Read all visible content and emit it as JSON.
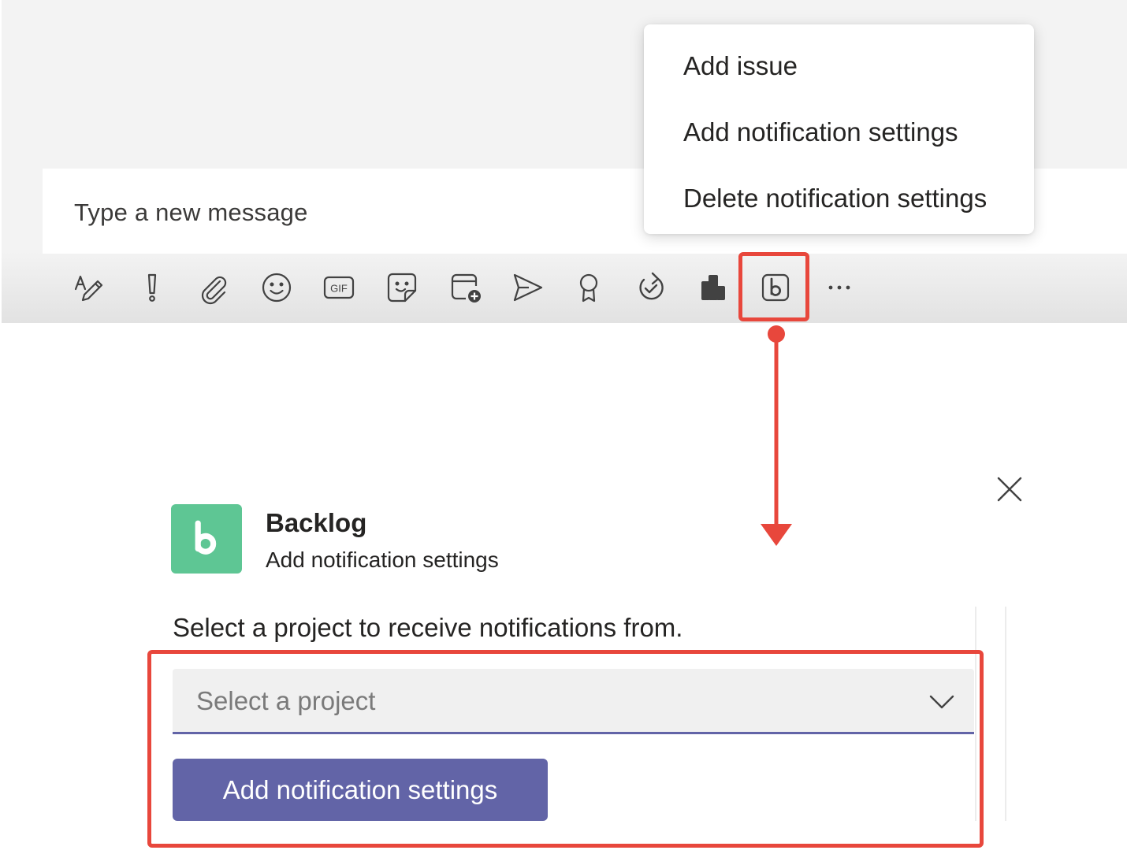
{
  "compose": {
    "placeholder": "Type a new message"
  },
  "toolbar": {
    "icons": [
      "format-icon",
      "important-icon",
      "attach-icon",
      "emoji-icon",
      "gif-icon",
      "sticker-icon",
      "schedule-meeting-icon",
      "send-icon",
      "praise-icon",
      "loop-icon",
      "app-icon",
      "backlog-icon",
      "more-icon"
    ],
    "gif_label": "GIF",
    "more_label": "···"
  },
  "menu": {
    "items": [
      {
        "label": "Add issue"
      },
      {
        "label": "Add notification settings"
      },
      {
        "label": "Delete notification settings"
      }
    ]
  },
  "dialog": {
    "app_name": "Backlog",
    "subtitle": "Add notification settings",
    "prompt": "Select a project to receive notifications from.",
    "select": {
      "placeholder": "Select a project"
    },
    "submit_label": "Add notification settings"
  },
  "colors": {
    "highlight": "#e8473c",
    "primary": "#6264a7",
    "backlog_green": "#5ec694"
  }
}
